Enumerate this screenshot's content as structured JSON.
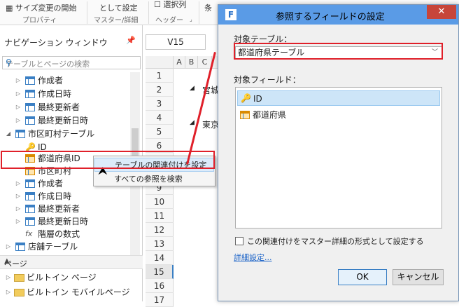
{
  "ribbon": {
    "btn_resize": "サイズ変更の開始",
    "btn_setting": "として設定",
    "btn_select": "選択列",
    "btn_cond": "条",
    "group_properties": "プロパティ",
    "group_master": "マスター/詳細",
    "group_header": "ヘッダー"
  },
  "nav": {
    "title": "ナビゲーション ウィンドウ",
    "search_placeholder": "テーブルとページの検索",
    "items": [
      {
        "label": "作成者",
        "type": "table",
        "indent": 2
      },
      {
        "label": "作成日時",
        "type": "table",
        "indent": 2
      },
      {
        "label": "最終更新者",
        "type": "table",
        "indent": 2
      },
      {
        "label": "最終更新日時",
        "type": "table",
        "indent": 2
      },
      {
        "label": "市区町村テーブル",
        "type": "table",
        "indent": 1,
        "expanded": true
      },
      {
        "label": "ID",
        "type": "key",
        "indent": 2
      },
      {
        "label": "都道府県ID",
        "type": "table",
        "indent": 2
      },
      {
        "label": "市区町村",
        "type": "table",
        "indent": 2
      },
      {
        "label": "作成者",
        "type": "table",
        "indent": 2
      },
      {
        "label": "作成日時",
        "type": "table",
        "indent": 2
      },
      {
        "label": "最終更新者",
        "type": "table",
        "indent": 2
      },
      {
        "label": "最終更新日時",
        "type": "table",
        "indent": 2
      },
      {
        "label": "階層の数式",
        "type": "fx",
        "indent": 2
      },
      {
        "label": "店舗テーブル",
        "type": "table",
        "indent": 1
      }
    ],
    "pages_header": "ページ",
    "pages": [
      {
        "label": "ビルトイン ページ"
      },
      {
        "label": "ビルトイン モバイルページ"
      }
    ]
  },
  "context_menu": {
    "items": [
      "テーブルの関連付けを設定",
      "すべての参照を検索"
    ]
  },
  "sheet": {
    "cell_ref": "V15",
    "columns": [
      "A",
      "B",
      "C"
    ],
    "rows": [
      "1",
      "2",
      "3",
      "4",
      "5",
      "6",
      "7",
      "8",
      "9",
      "10",
      "11",
      "12",
      "13",
      "14",
      "15",
      "16",
      "17"
    ],
    "cell_miyagi": "宮城",
    "cell_tokyo": "東京"
  },
  "dialog": {
    "title": "参照するフィールドの設定",
    "close_label": "✕",
    "target_table_label": "対象テーブル：",
    "target_table_value": "都道府県テーブル",
    "target_field_label": "対象フィールド：",
    "fields": [
      {
        "label": "ID",
        "type": "key",
        "selected": true
      },
      {
        "label": "都道府県",
        "type": "table",
        "selected": false
      }
    ],
    "checkbox_label": "この関連付けをマスター詳細の形式として設定する",
    "details_link": "詳細設定...",
    "ok": "OK",
    "cancel": "キャンセル"
  }
}
